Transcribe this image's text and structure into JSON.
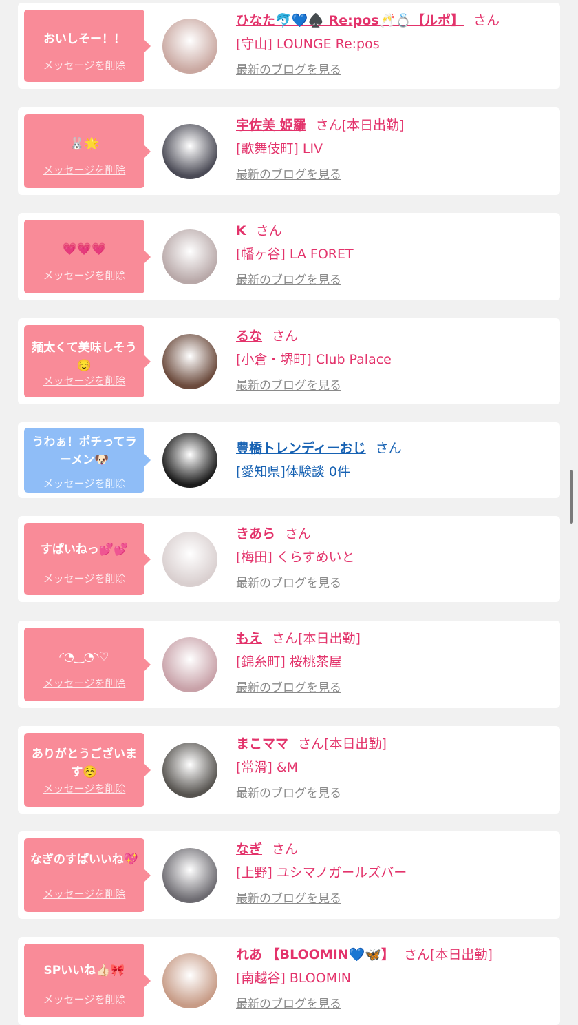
{
  "common": {
    "delete_label": "メッセージを削除",
    "san": "さん",
    "blog_label": "最新のブログを見る"
  },
  "items": [
    {
      "msg": "おいしそー！！",
      "name": "ひなた🐬💙♠️ Re:pos🥂💍【ルポ】",
      "san": "さん",
      "tag": "",
      "shop": "[守山] LOUNGE Re:pos",
      "blog": "最新のブログを見る",
      "avatar_color": "#c9a7a0"
    },
    {
      "msg": "🐰🌟",
      "name": "宇佐美 姫羅",
      "san": "さん",
      "tag": "[本日出勤]",
      "shop": "[歌舞伎町] LIV",
      "blog": "最新のブログを見る",
      "avatar_color": "#4a4a55"
    },
    {
      "msg": "💗💗💗",
      "name": "K",
      "san": "さん",
      "tag": "",
      "shop": "[幡ヶ谷] LA FORET",
      "blog": "最新のブログを見る",
      "avatar_color": "#b8a8a8"
    },
    {
      "msg": "麺太くて美味しそう☺️",
      "name": "るな",
      "san": "さん",
      "tag": "",
      "shop": "[小倉・堺町] Club Palace",
      "blog": "最新のブログを見る",
      "avatar_color": "#6b4a3c"
    },
    {
      "msg": "うわぁ！ポチってラーメン🐶",
      "name": "豊橋トレンディーおじ",
      "san": "さん",
      "tag": "",
      "shop": "[愛知県]体験談 0件",
      "blog": "",
      "avatar_color": "#1c1c1c",
      "variant": "blue"
    },
    {
      "msg": "すぱいねっ💕💕",
      "name": "きあら",
      "san": "さん",
      "tag": "",
      "shop": "[梅田] くらすめいと",
      "blog": "最新のブログを見る",
      "avatar_color": "#d9cfcf"
    },
    {
      "msg": "◜◔‿◔◝♡",
      "name": "もえ",
      "san": "さん",
      "tag": "[本日出勤]",
      "shop": "[錦糸町] 桜桃茶屋",
      "blog": "最新のブログを見る",
      "avatar_color": "#c8a1a8"
    },
    {
      "msg": "ありがとうございます☺️",
      "name": "まこママ",
      "san": "さん",
      "tag": "[本日出勤]",
      "shop": "[常滑] &M",
      "blog": "最新のブログを見る",
      "avatar_color": "#56534f"
    },
    {
      "msg": "なぎのすぱいいね💖",
      "name": "なぎ",
      "san": "さん",
      "tag": "",
      "shop": "[上野] ユシマノガールズバー",
      "blog": "最新のブログを見る",
      "avatar_color": "#6c6a70"
    },
    {
      "msg": "SPいいね👍🏻🎀",
      "name": "れあ 【BLOOMIN💙🦋】",
      "san": "さん",
      "tag": "[本日出勤]",
      "shop": "[南越谷] BLOOMIN",
      "blog": "最新のブログを見る",
      "avatar_color": "#c79b86"
    }
  ]
}
